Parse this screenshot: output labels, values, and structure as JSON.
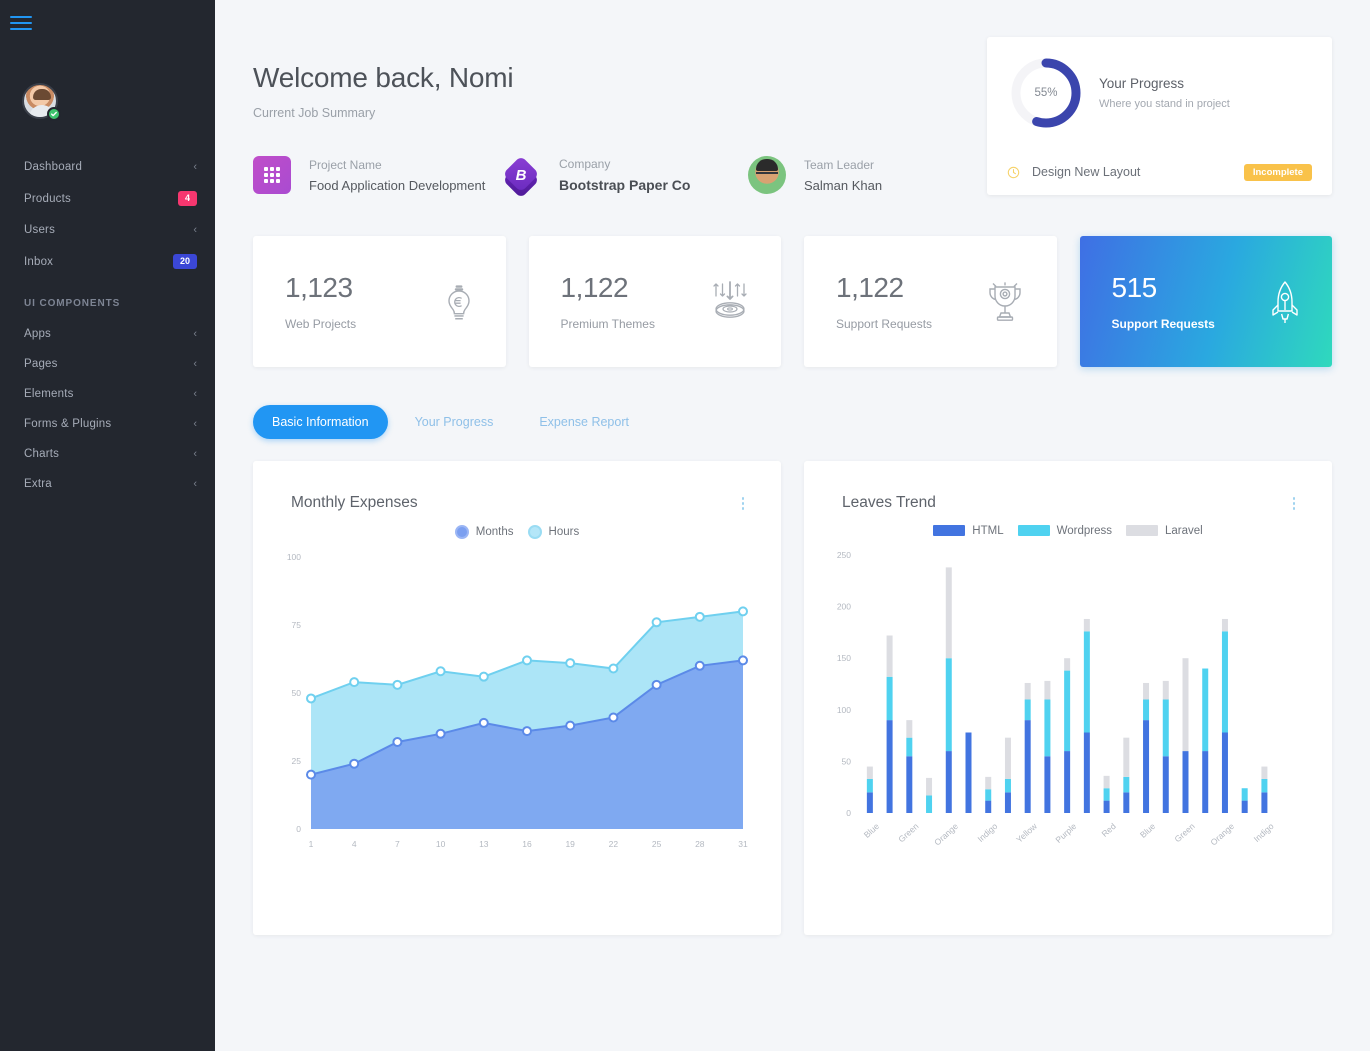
{
  "sidebar": {
    "hamburger": "menu-icon",
    "items": [
      {
        "label": "Dashboard",
        "chevron": "‹",
        "badge": null
      },
      {
        "label": "Products",
        "chevron": null,
        "badge": "4",
        "badge_color": "#f6376f"
      },
      {
        "label": "Users",
        "chevron": "‹",
        "badge": null
      },
      {
        "label": "Inbox",
        "chevron": null,
        "badge": "20",
        "badge_color": "#3b47d6"
      }
    ],
    "section_label": "UI COMPONENTS",
    "section_items": [
      {
        "label": "Apps",
        "chevron": "‹"
      },
      {
        "label": "Pages",
        "chevron": "‹"
      },
      {
        "label": "Elements",
        "chevron": "‹"
      },
      {
        "label": "Forms & Plugins",
        "chevron": "‹"
      },
      {
        "label": "Charts",
        "chevron": "‹"
      },
      {
        "label": "Extra",
        "chevron": "‹"
      }
    ]
  },
  "header": {
    "title": "Welcome back, Nomi",
    "subtitle": "Current Job Summary"
  },
  "meta": [
    {
      "key": "Project Name",
      "value": "Food Application Development",
      "icon": "grid-icon"
    },
    {
      "key": "Company",
      "value": "Bootstrap Paper Co",
      "icon": "bootstrap-cube-icon"
    },
    {
      "key": "Team Leader",
      "value": "Salman Khan",
      "icon": "avatar-icon"
    }
  ],
  "progress_card": {
    "percent_label": "55%",
    "percent_value": 55,
    "title": "Your Progress",
    "subtitle": "Where you stand in project",
    "task": "Design New Layout",
    "status_chip": "Incomplete",
    "ring_color": "#3b45ad",
    "track_color": "#f4f4f7",
    "chip_color": "#f9c24a"
  },
  "stats": [
    {
      "value": "1,123",
      "label": "Web Projects",
      "icon": "lightbulb-euro-icon",
      "accent": false
    },
    {
      "value": "1,122",
      "label": "Premium Themes",
      "icon": "cd-download-icon",
      "accent": false
    },
    {
      "value": "1,122",
      "label": "Support Requests",
      "icon": "trophy-icon",
      "accent": false
    },
    {
      "value": "515",
      "label": "Support Requests",
      "icon": "rocket-icon",
      "accent": true
    }
  ],
  "tabs": [
    {
      "label": "Basic Information",
      "active": true
    },
    {
      "label": "Your Progress",
      "active": false
    },
    {
      "label": "Expense Report",
      "active": false
    }
  ],
  "chart_data": [
    {
      "type": "area",
      "title": "Monthly Expenses",
      "menu_icon": "more-vertical-icon",
      "xlabel": "",
      "ylabel": "",
      "ylim": [
        0,
        100
      ],
      "yticks": [
        0,
        25,
        50,
        75,
        100
      ],
      "grid": false,
      "legend_position": "top-center",
      "x": [
        1,
        4,
        7,
        10,
        13,
        16,
        19,
        22,
        25,
        28,
        31
      ],
      "series": [
        {
          "name": "Months",
          "color": "#7ca5f0",
          "line_color": "#5b8ae8",
          "values": [
            20,
            24,
            32,
            35,
            39,
            36,
            38,
            41,
            53,
            60,
            62
          ]
        },
        {
          "name": "Hours",
          "color": "#a8e4f7",
          "line_color": "#6fd0ef",
          "values": [
            48,
            54,
            53,
            58,
            56,
            62,
            61,
            59,
            76,
            78,
            80
          ]
        }
      ]
    },
    {
      "type": "bar",
      "title": "Leaves Trend",
      "menu_icon": "more-vertical-icon",
      "stacked": true,
      "xlabel": "",
      "ylabel": "",
      "ylim": [
        0,
        250
      ],
      "yticks": [
        0,
        50,
        100,
        150,
        200,
        250
      ],
      "grid": false,
      "legend_position": "top-center",
      "categories": [
        "Blue",
        "Green",
        "Orange",
        "Indigo",
        "Yellow",
        "Purple",
        "Red",
        "Blue",
        "Green",
        "Orange",
        "Indigo"
      ],
      "bars_per_category": 2,
      "series": [
        {
          "name": "HTML",
          "color": "#4274e0",
          "values": [
            20,
            0,
            90,
            55,
            0,
            60,
            78,
            12,
            0,
            20,
            90,
            55,
            0,
            60,
            78,
            12,
            0,
            20,
            90,
            55,
            0,
            60
          ]
        },
        {
          "name": "Wordpress",
          "color": "#4fd2f0",
          "values": [
            13,
            0,
            42,
            18,
            17,
            90,
            0,
            11,
            0,
            13,
            20,
            55,
            0,
            78,
            98,
            12,
            0,
            15,
            20,
            82,
            0,
            12
          ]
        },
        {
          "name": "Laravel",
          "color": "#dcdde2",
          "values": [
            12,
            0,
            40,
            16,
            17,
            88,
            0,
            12,
            0,
            40,
            128,
            16,
            0,
            18,
            12,
            12,
            0,
            18,
            16,
            28,
            0,
            0
          ]
        }
      ],
      "bar_data": [
        {
          "html": 20,
          "wordpress": 13,
          "laravel": 12
        },
        {
          "html": 90,
          "wordpress": 42,
          "laravel": 40
        },
        {
          "html": 55,
          "wordpress": 18,
          "laravel": 17
        },
        {
          "html": 0,
          "wordpress": 17,
          "laravel": 17
        },
        {
          "html": 60,
          "wordpress": 90,
          "laravel": 88
        },
        {
          "html": 78,
          "wordpress": 0,
          "laravel": 0
        },
        {
          "html": 12,
          "wordpress": 11,
          "laravel": 12
        },
        {
          "html": 20,
          "wordpress": 13,
          "laravel": 40
        },
        {
          "html": 90,
          "wordpress": 20,
          "laravel": 16
        },
        {
          "html": 55,
          "wordpress": 55,
          "laravel": 18
        },
        {
          "html": 60,
          "wordpress": 78,
          "laravel": 12
        },
        {
          "html": 78,
          "wordpress": 98,
          "laravel": 12
        },
        {
          "html": 12,
          "wordpress": 12,
          "laravel": 12
        },
        {
          "html": 20,
          "wordpress": 15,
          "laravel": 38
        },
        {
          "html": 90,
          "wordpress": 20,
          "laravel": 16
        },
        {
          "html": 55,
          "wordpress": 55,
          "laravel": 18
        },
        {
          "html": 60,
          "wordpress": 0,
          "laravel": 90
        },
        {
          "html": 60,
          "wordpress": 80,
          "laravel": 0
        },
        {
          "html": 78,
          "wordpress": 98,
          "laravel": 12
        },
        {
          "html": 12,
          "wordpress": 12,
          "laravel": 0
        },
        {
          "html": 20,
          "wordpress": 13,
          "laravel": 12
        },
        {
          "html": 0,
          "wordpress": 0,
          "laravel": 0
        }
      ]
    }
  ]
}
